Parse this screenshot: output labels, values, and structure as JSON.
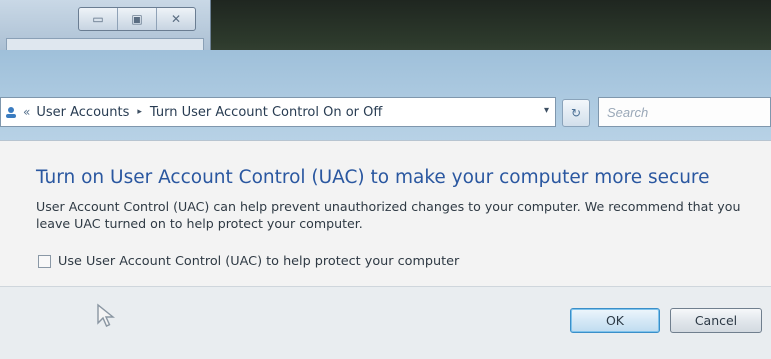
{
  "back_window": {
    "buttons": [
      {
        "name": "minimize-button",
        "icon": "minimize-icon",
        "glyph": "▭"
      },
      {
        "name": "maximize-button",
        "icon": "maximize-icon",
        "glyph": "▣"
      },
      {
        "name": "close-button",
        "icon": "close-icon",
        "glyph": "✕"
      }
    ]
  },
  "address_bar": {
    "icon": "control-panel-icon",
    "overflow": "«",
    "breadcrumbs": [
      "User Accounts",
      "Turn User Account Control On or Off"
    ],
    "separator": "▸",
    "dropdown": "▾"
  },
  "refresh_glyph": "↻",
  "search": {
    "placeholder": "Search"
  },
  "content": {
    "title": "Turn on User Account Control (UAC) to make your computer more secure",
    "description": "User Account Control (UAC) can help prevent unauthorized changes to your computer. We recommend that you leave UAC turned on to help protect your computer.",
    "checkbox_label": "Use User Account Control (UAC) to help protect your computer",
    "checkbox_checked": false
  },
  "footer": {
    "ok_label": "OK",
    "cancel_label": "Cancel"
  },
  "colors": {
    "title": "#2a57a0",
    "ok_focus": "#3a8fc9"
  }
}
